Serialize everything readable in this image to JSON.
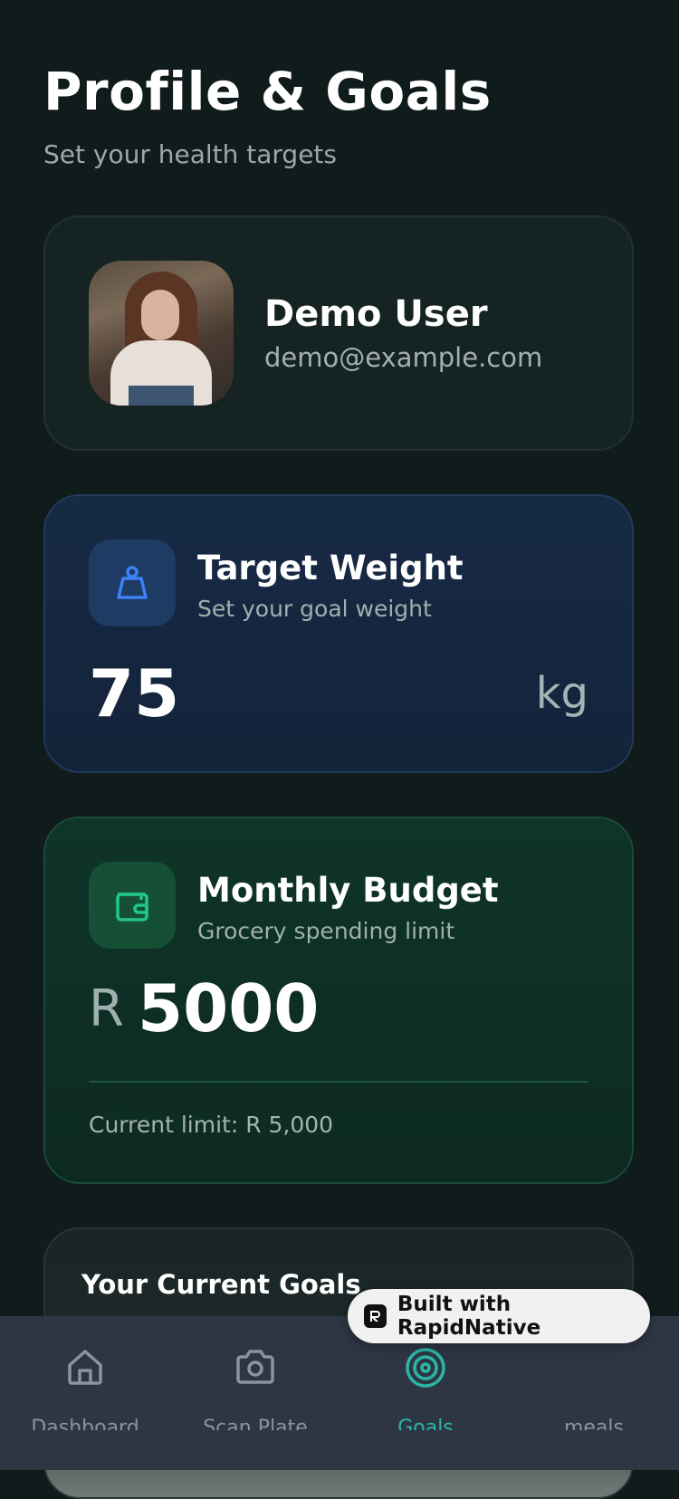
{
  "header": {
    "title": "Profile & Goals",
    "subtitle": "Set your health targets"
  },
  "profile": {
    "name": "Demo User",
    "email": "demo@example.com"
  },
  "weight": {
    "title": "Target Weight",
    "subtitle": "Set your goal weight",
    "value": "75",
    "unit": "kg",
    "icon": "weight-icon"
  },
  "budget": {
    "title": "Monthly Budget",
    "subtitle": "Grocery spending limit",
    "currency": "R",
    "value": "5000",
    "current_limit": "Current limit: R 5,000",
    "icon": "wallet-icon"
  },
  "goals": {
    "title": "Your Current Goals"
  },
  "nav": [
    {
      "label": "Dashboard",
      "icon": "home-icon",
      "active": false
    },
    {
      "label": "Scan Plate",
      "icon": "camera-icon",
      "active": false
    },
    {
      "label": "Goals",
      "icon": "target-icon",
      "active": true
    },
    {
      "label": "meals",
      "icon": "",
      "active": false
    }
  ],
  "badge": {
    "text": "Built with RapidNative"
  },
  "colors": {
    "background": "#101b1c",
    "accent": "#2bb6a6",
    "weight_icon": "#3b82f6",
    "budget_icon": "#22c58b"
  }
}
